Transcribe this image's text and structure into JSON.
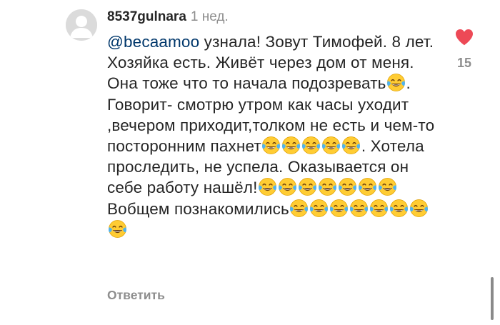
{
  "comment": {
    "username": "8537gulnara",
    "time": "1 нед.",
    "mention": "@becaamoo",
    "segments": [
      " узнала! Зовут Тимофей. 8 лет. Хозяйка есть. Живёт через дом от меня. Она тоже что то начала подозревать",
      ". Говорит- смотрю утром как часы уходит ,вечером приходит,толком не есть и чем-то посторонним пахнет",
      ". Хотела проследить, не успела. Оказывается он себе работу нашёл!",
      " Вобщем познакомились",
      ""
    ],
    "emoji_name": "face-with-tears-of-joy",
    "emoji_groups": [
      1,
      5,
      7,
      1,
      7
    ],
    "reply_label": "Ответить",
    "like_count": "15",
    "liked": true
  },
  "colors": {
    "username": "#262626",
    "mention": "#00376b",
    "muted": "#8e8e8e",
    "heart": "#ed4956",
    "avatar_bg": "#dbdbdb"
  },
  "icons": {
    "avatar": "default-avatar-icon",
    "like": "heart-icon",
    "emoji": "face-with-tears-of-joy-icon"
  }
}
